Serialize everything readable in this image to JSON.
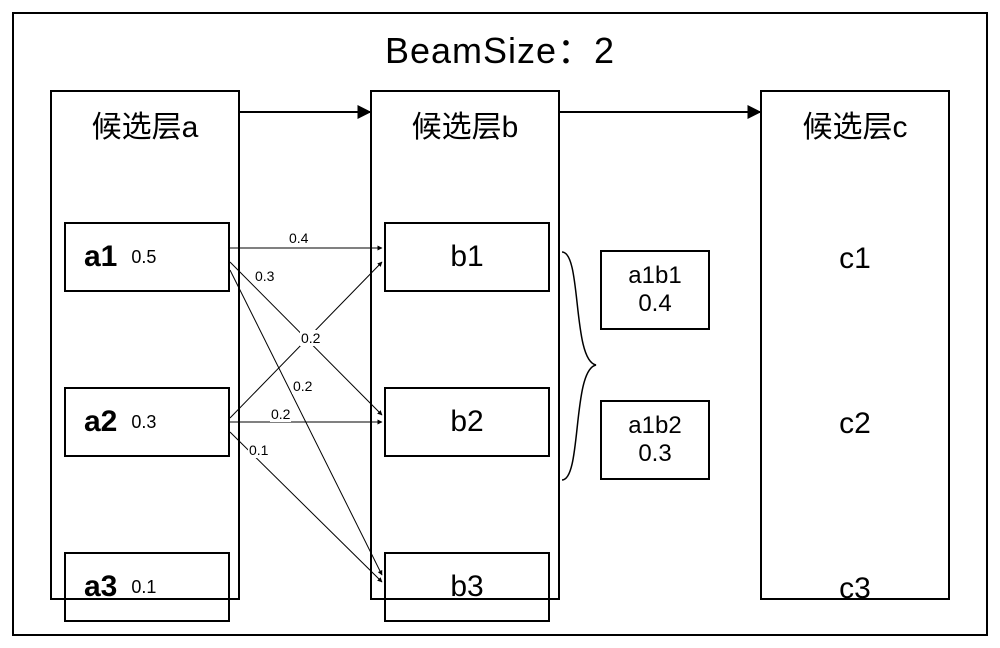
{
  "title": "BeamSize：2",
  "layers": {
    "a": {
      "title": "候选层a",
      "nodes": [
        {
          "label": "a1",
          "score": "0.5"
        },
        {
          "label": "a2",
          "score": "0.3"
        },
        {
          "label": "a3",
          "score": "0.1"
        }
      ]
    },
    "b": {
      "title": "候选层b",
      "nodes": [
        {
          "label": "b1"
        },
        {
          "label": "b2"
        },
        {
          "label": "b3"
        }
      ]
    },
    "c": {
      "title": "候选层c",
      "nodes": [
        {
          "label": "c1"
        },
        {
          "label": "c2"
        },
        {
          "label": "c3"
        }
      ]
    }
  },
  "edges": [
    {
      "from": "a1",
      "to": "b1",
      "weight": "0.4"
    },
    {
      "from": "a1",
      "to": "b2",
      "weight": "0.3"
    },
    {
      "from": "a1",
      "to": "b3",
      "weight": "0.2"
    },
    {
      "from": "a2",
      "to": "b1",
      "weight": "0.2"
    },
    {
      "from": "a2",
      "to": "b2",
      "weight": "0.2"
    },
    {
      "from": "a2",
      "to": "b3",
      "weight": "0.1"
    }
  ],
  "paths": [
    {
      "label": "a1b1",
      "score": "0.4"
    },
    {
      "label": "a1b2",
      "score": "0.3"
    }
  ],
  "chart_data": {
    "type": "diagram",
    "beam_size": 2,
    "layers": [
      "候选层a",
      "候选层b",
      "候选层c"
    ],
    "candidates": {
      "a": [
        {
          "id": "a1",
          "prob": 0.5
        },
        {
          "id": "a2",
          "prob": 0.3
        },
        {
          "id": "a3",
          "prob": 0.1
        }
      ],
      "b": [
        {
          "id": "b1"
        },
        {
          "id": "b2"
        },
        {
          "id": "b3"
        }
      ],
      "c": [
        {
          "id": "c1"
        },
        {
          "id": "c2"
        },
        {
          "id": "c3"
        }
      ]
    },
    "transitions_a_to_b": [
      {
        "from": "a1",
        "to": "b1",
        "prob": 0.4
      },
      {
        "from": "a1",
        "to": "b2",
        "prob": 0.3
      },
      {
        "from": "a1",
        "to": "b3",
        "prob": 0.2
      },
      {
        "from": "a2",
        "to": "b1",
        "prob": 0.2
      },
      {
        "from": "a2",
        "to": "b2",
        "prob": 0.2
      },
      {
        "from": "a2",
        "to": "b3",
        "prob": 0.1
      }
    ],
    "selected_paths": [
      {
        "path": "a1b1",
        "score": 0.4
      },
      {
        "path": "a1b2",
        "score": 0.3
      }
    ]
  }
}
